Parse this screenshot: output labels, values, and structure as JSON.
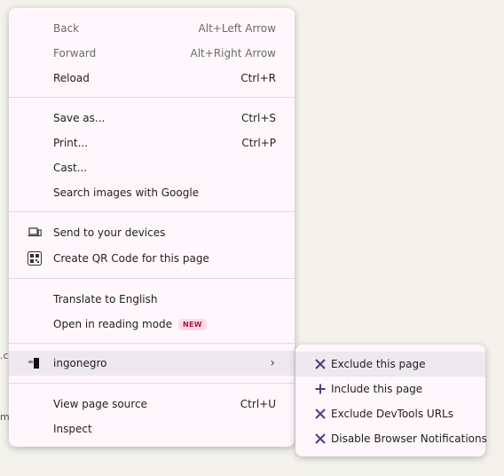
{
  "background_fragments": [
    ".c",
    "m"
  ],
  "main_menu": {
    "back": {
      "label": "Back",
      "shortcut": "Alt+Left Arrow"
    },
    "forward": {
      "label": "Forward",
      "shortcut": "Alt+Right Arrow"
    },
    "reload": {
      "label": "Reload",
      "shortcut": "Ctrl+R"
    },
    "save_as": {
      "label": "Save as...",
      "shortcut": "Ctrl+S"
    },
    "print": {
      "label": "Print...",
      "shortcut": "Ctrl+P"
    },
    "cast": {
      "label": "Cast..."
    },
    "search_images": {
      "label": "Search images with Google"
    },
    "send_devices": {
      "label": "Send to your devices"
    },
    "qr_code": {
      "label": "Create QR Code for this page"
    },
    "translate": {
      "label": "Translate to English"
    },
    "reading_mode": {
      "label": "Open in reading mode",
      "badge": "NEW"
    },
    "extension": {
      "label": "ingonegro"
    },
    "view_source": {
      "label": "View page source",
      "shortcut": "Ctrl+U"
    },
    "inspect": {
      "label": "Inspect"
    }
  },
  "submenu": {
    "items": [
      {
        "label": "Exclude this page",
        "icon": "x-icon"
      },
      {
        "label": "Include this page",
        "icon": "plus-icon"
      },
      {
        "label": "Exclude DevTools URLs",
        "icon": "x-icon"
      },
      {
        "label": "Disable Browser Notifications",
        "icon": "x-icon"
      }
    ]
  },
  "colors": {
    "menu_bg": "#fff7fc",
    "separator": "#ecd6e4",
    "hover": "#ede9ee",
    "submenu_icon": "#4b3f86",
    "badge_bg": "#fbdce5",
    "badge_text": "#b3123b"
  }
}
